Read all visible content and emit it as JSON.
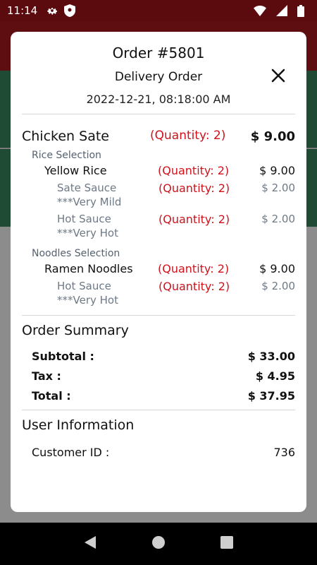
{
  "status_bar": {
    "time": "11:14"
  },
  "order": {
    "title": "Order #5801",
    "type": "Delivery Order",
    "datetime": "2022-12-21, 08:18:00 AM"
  },
  "item": {
    "name": "Chicken Sate",
    "quantity": "(Quantity: 2)",
    "price": "$ 9.00",
    "rice_section": {
      "label": "Rice Selection",
      "choice": {
        "name": "Yellow Rice",
        "quantity": "(Quantity: 2)",
        "price": "$ 9.00"
      },
      "options": [
        {
          "name": "Sate Sauce",
          "quantity": "(Quantity: 2)",
          "price": "$ 2.00",
          "note": "***Very Mild"
        },
        {
          "name": "Hot Sauce",
          "quantity": "(Quantity: 2)",
          "price": "$ 2.00",
          "note": "***Very Hot"
        }
      ]
    },
    "noodles_section": {
      "label": "Noodles Selection",
      "choice": {
        "name": "Ramen Noodles",
        "quantity": "(Quantity: 2)",
        "price": "$ 9.00"
      },
      "options": [
        {
          "name": "Hot Sauce",
          "quantity": "(Quantity: 2)",
          "price": "$ 2.00",
          "note": "***Very Hot"
        }
      ]
    }
  },
  "summary": {
    "title": "Order Summary",
    "subtotal_label": "Subtotal :",
    "subtotal": "$ 33.00",
    "tax_label": "Tax :",
    "tax": "$ 4.95",
    "total_label": "Total :",
    "total": "$ 37.95"
  },
  "user_info": {
    "title": "User Information",
    "customer_id_label": "Customer ID :",
    "customer_id": "736"
  },
  "colors": {
    "accent_red": "#d0121b",
    "status_bar": "#5b0a0d",
    "muted_text": "#6d7986"
  }
}
